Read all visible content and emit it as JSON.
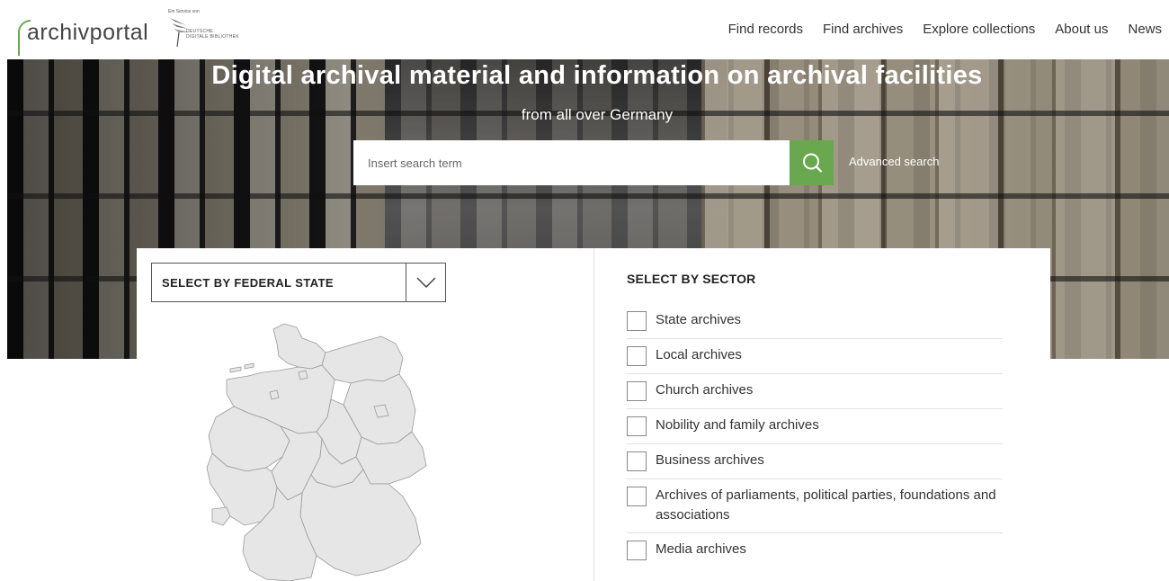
{
  "header": {
    "logo_text": "archivportal",
    "ddb_tagline": "Ein Service von",
    "ddb_name_line1": "Deutsche",
    "ddb_name_line2": "Digitale Bibliothek",
    "nav": [
      "Find records",
      "Find archives",
      "Explore collections",
      "About us",
      "News"
    ]
  },
  "hero": {
    "title": "Digital archival material and information on archival facilities",
    "subtitle": "from all over Germany",
    "search_placeholder": "Insert search term",
    "search_icon": "search-icon",
    "advanced_search": "Advanced search"
  },
  "state_select": {
    "label": "SELECT BY FEDERAL STATE",
    "icon": "chevron-down-icon"
  },
  "sector": {
    "title": "SELECT BY SECTOR",
    "items": [
      "State archives",
      "Local archives",
      "Church archives",
      "Nobility and family archives",
      "Business archives",
      "Archives of parliaments, political parties, foundations and associations",
      "Media archives"
    ]
  },
  "colors": {
    "accent": "#6aa84f",
    "map_fill": "#e6e6e6",
    "map_stroke": "#9a9a9a"
  }
}
